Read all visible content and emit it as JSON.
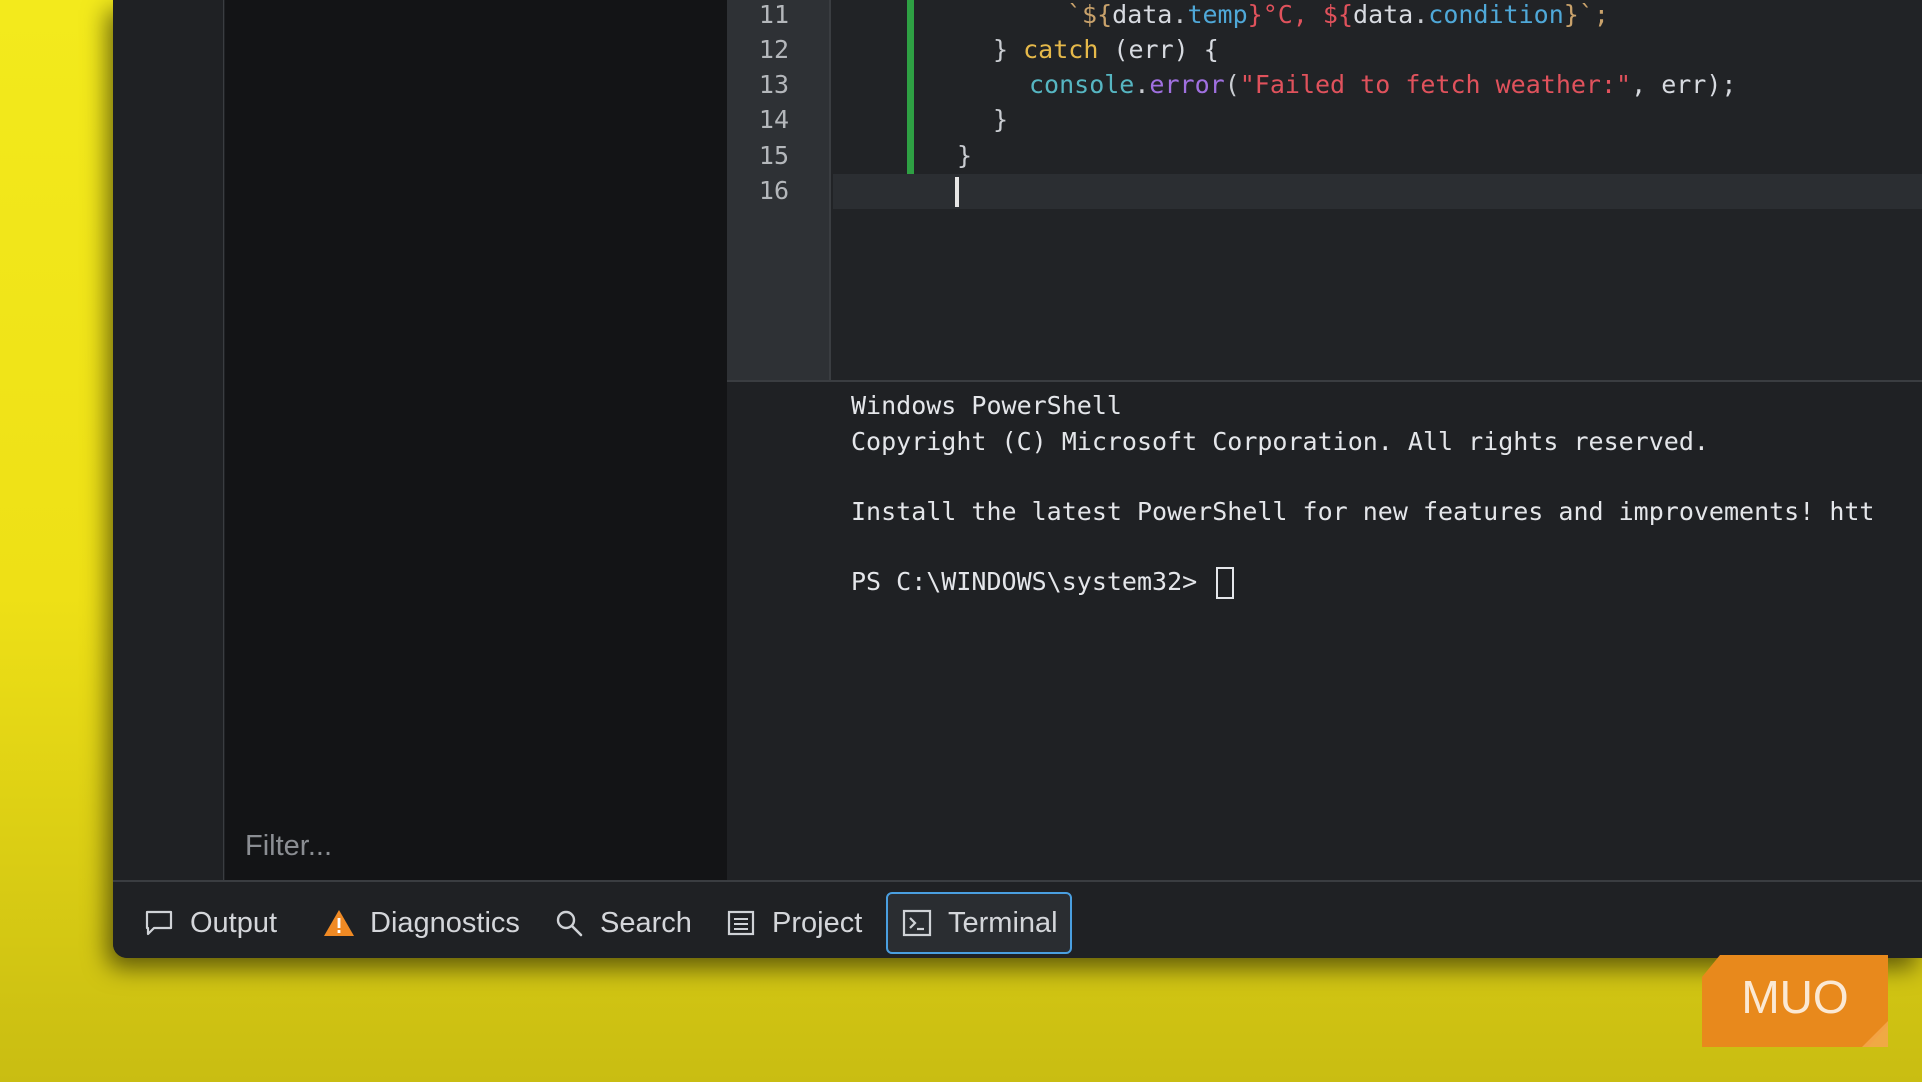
{
  "editor": {
    "lines": [
      {
        "num": "11"
      },
      {
        "num": "12"
      },
      {
        "num": "13"
      },
      {
        "num": "14"
      },
      {
        "num": "15"
      },
      {
        "num": "16"
      }
    ],
    "code": {
      "l11a": "`${",
      "l11b": "data",
      "l11c": ".",
      "l11d": "temp",
      "l11e": "}°C, ${",
      "l11f": "data",
      "l11g": ".",
      "l11h": "condition",
      "l11i": "}`;",
      "l12a": "} ",
      "l12b": "catch",
      "l12c": " (err) {",
      "l13a": "console",
      "l13b": ".",
      "l13c": "error",
      "l13d": "(",
      "l13e": "\"Failed to fetch weather:\"",
      "l13f": ", err);",
      "l14": "}",
      "l15": "}"
    }
  },
  "terminal": {
    "line1": "Windows PowerShell",
    "line2": "Copyright (C) Microsoft Corporation. All rights reserved.",
    "line3": "Install the latest PowerShell for new features and improvements! htt",
    "prompt": "PS C:\\WINDOWS\\system32> "
  },
  "sidebar": {
    "filter_placeholder": "Filter..."
  },
  "panel_tabs": [
    {
      "label": "Output",
      "icon": "message-icon"
    },
    {
      "label": "Diagnostics",
      "icon": "warning-icon"
    },
    {
      "label": "Search",
      "icon": "search-icon"
    },
    {
      "label": "Project",
      "icon": "list-icon"
    },
    {
      "label": "Terminal",
      "icon": "terminal-icon",
      "active": true
    }
  ],
  "colors": {
    "background": "#f3ea1c",
    "accent": "#4a9fe0",
    "git_added": "#2ea043",
    "warning": "#f08a24",
    "logo": "#e8891c"
  },
  "logo": {
    "text": "MUO"
  }
}
